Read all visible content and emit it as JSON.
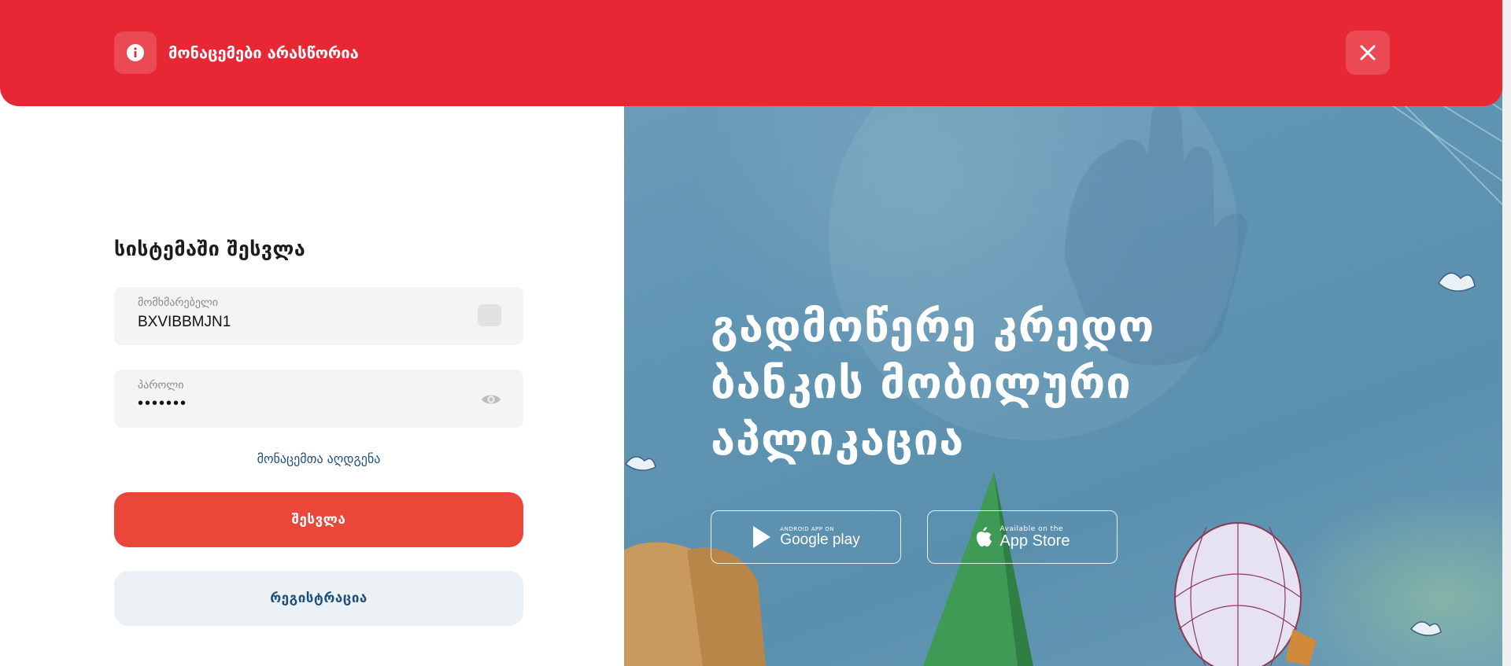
{
  "banner": {
    "message": "მონაცემები არასწორია",
    "icon": "info-icon",
    "close_icon": "close-icon",
    "color": "#e72834"
  },
  "login": {
    "title": "სისტემაში შესვლა",
    "username": {
      "label": "მომხმარებელი",
      "value": "BXVIBBMJN1"
    },
    "password": {
      "label": "პაროლი",
      "value": "•••••••",
      "toggle_icon": "eye-icon"
    },
    "forgot_link": "მონაცემთა აღდგენა",
    "login_button": "შესვლა",
    "register_button": "რეგისტრაცია",
    "accent_color": "#e8473a"
  },
  "promo": {
    "title": "გადმოწერე კრედო ბანკის მობილური აპლიკაცია",
    "google_play": {
      "small": "ANDROID APP ON",
      "big": "Google play",
      "icon": "play-icon"
    },
    "app_store": {
      "small": "Available on the",
      "big": "App Store",
      "icon": "apple-icon"
    }
  }
}
